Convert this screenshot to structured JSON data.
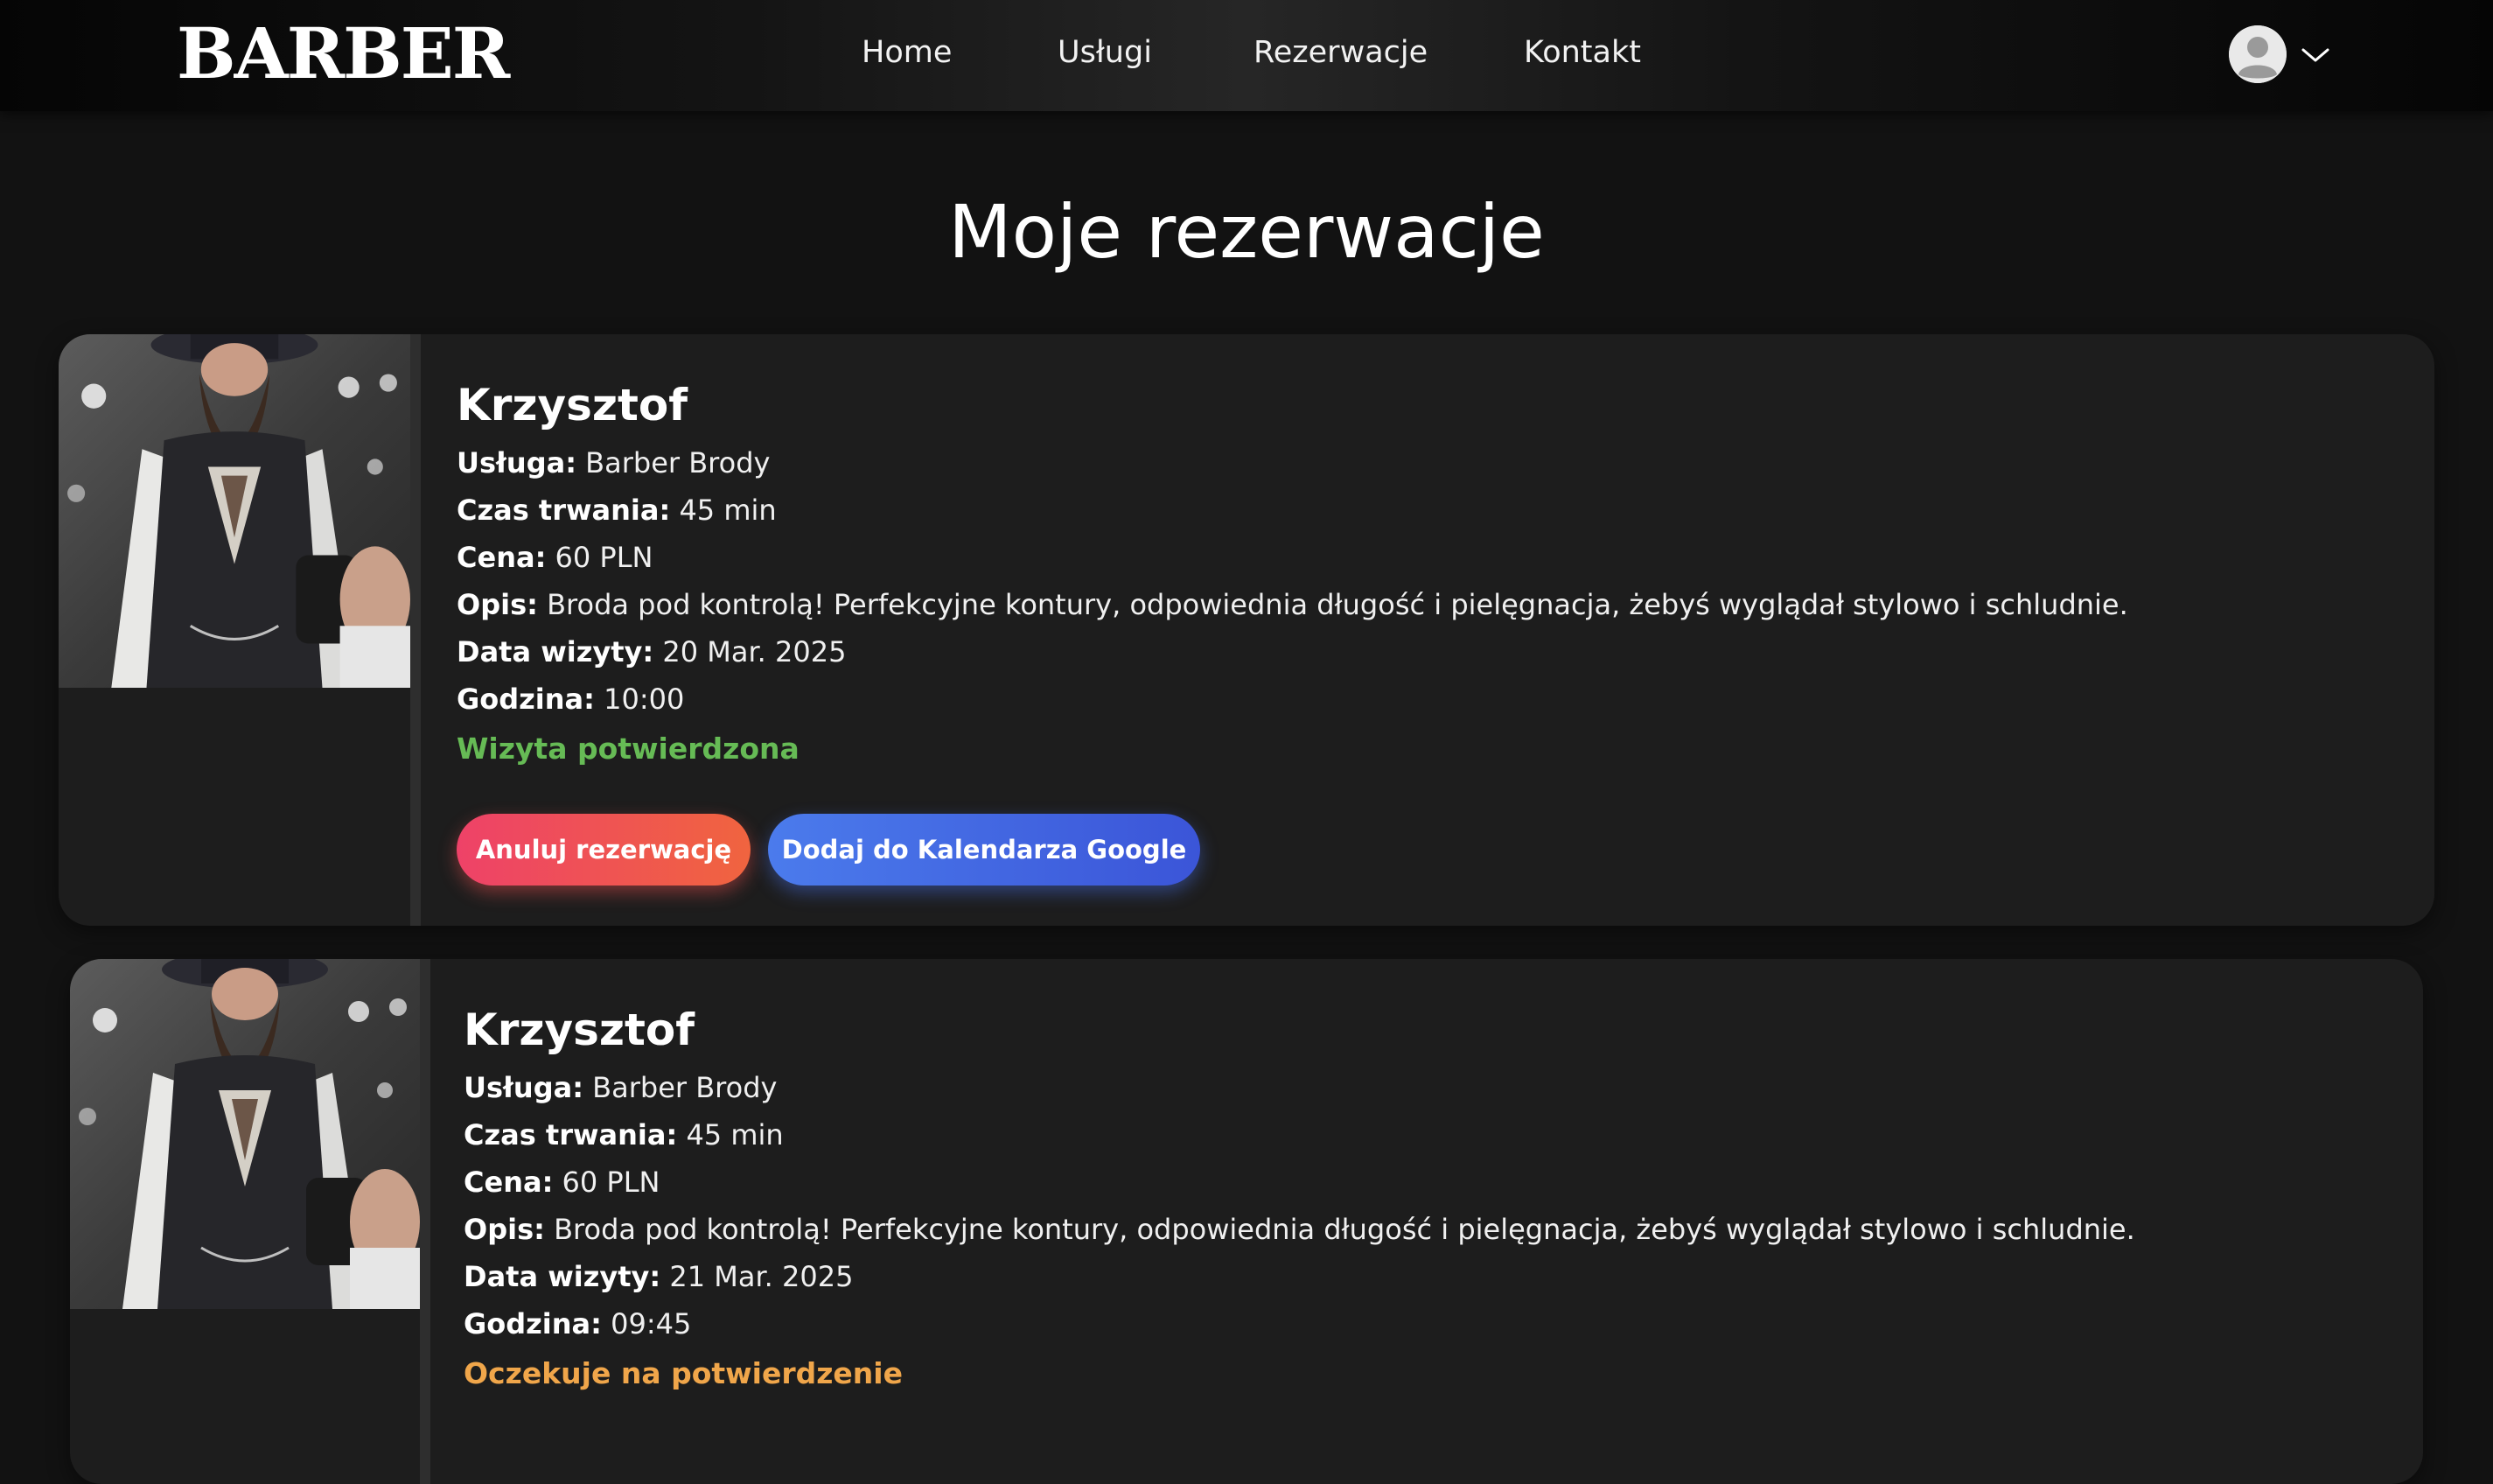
{
  "header": {
    "logo": "BARBER",
    "nav": [
      {
        "label": "Home"
      },
      {
        "label": "Usługi"
      },
      {
        "label": "Rezerwacje"
      },
      {
        "label": "Kontakt"
      }
    ],
    "avatar_icon": "user-avatar-icon",
    "menu_icon": "chevron-down-icon"
  },
  "page": {
    "title": "Moje rezerwacje"
  },
  "labels": {
    "service": "Usługa:",
    "duration": "Czas trwania:",
    "price": "Cena:",
    "description": "Opis:",
    "date": "Data wizyty:",
    "time": "Godzina:"
  },
  "reservations": [
    {
      "barber": "Krzysztof",
      "service": "Barber Brody",
      "duration": "45 min",
      "price": "60 PLN",
      "description": "Broda pod kontrolą! Perfekcyjne kontury, odpowiednia długość i pielęgnacja, żebyś wyglądał stylowo i schludnie.",
      "date": "20 Mar. 2025",
      "time": "10:00",
      "status": "Wizyta potwierdzona",
      "status_color": "#66bb55",
      "actions": {
        "cancel": "Anuluj rezerwację",
        "calendar": "Dodaj do Kalendarza Google"
      }
    },
    {
      "barber": "Krzysztof",
      "service": "Barber Brody",
      "duration": "45 min",
      "price": "60 PLN",
      "description": "Broda pod kontrolą! Perfekcyjne kontury, odpowiednia długość i pielęgnacja, żebyś wyglądał stylowo i schludnie.",
      "date": "21 Mar. 2025",
      "time": "09:45",
      "status": "Oczekuje na potwierdzenie",
      "status_color": "#f0a64a"
    }
  ],
  "colors": {
    "background": "#121212",
    "card": "#1d1d1d",
    "confirmed": "#66bb55",
    "pending": "#f0a64a",
    "cancel_button": "#ee4268",
    "google_button": "#4b7bec"
  }
}
